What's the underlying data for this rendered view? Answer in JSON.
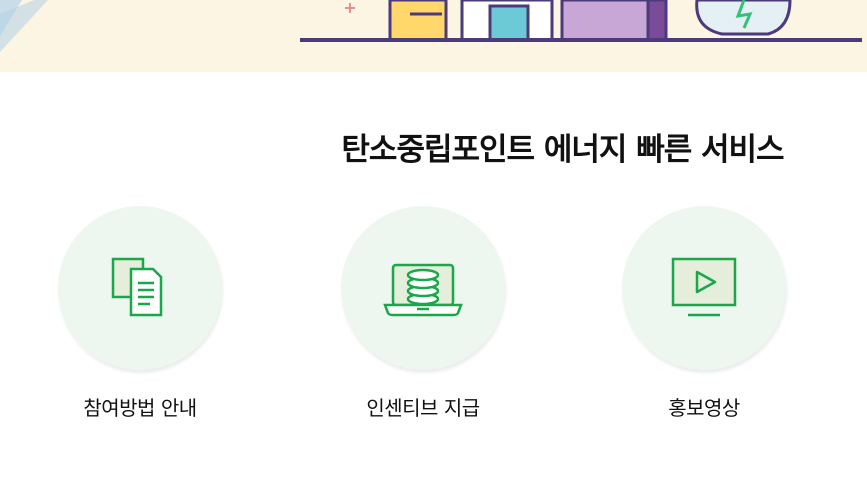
{
  "banner": {
    "bg_color": "#fdf5e3"
  },
  "section": {
    "title": "탄소중립포인트 에너지 빠른 서비스"
  },
  "services": [
    {
      "label": "참여방법 안내",
      "icon": "documents-icon"
    },
    {
      "label": "인센티브 지급",
      "icon": "laptop-coins-icon"
    },
    {
      "label": "홍보영상",
      "icon": "video-play-icon"
    }
  ],
  "colors": {
    "icon_green": "#1aa64a",
    "circle_bg": "#edf6ef"
  }
}
